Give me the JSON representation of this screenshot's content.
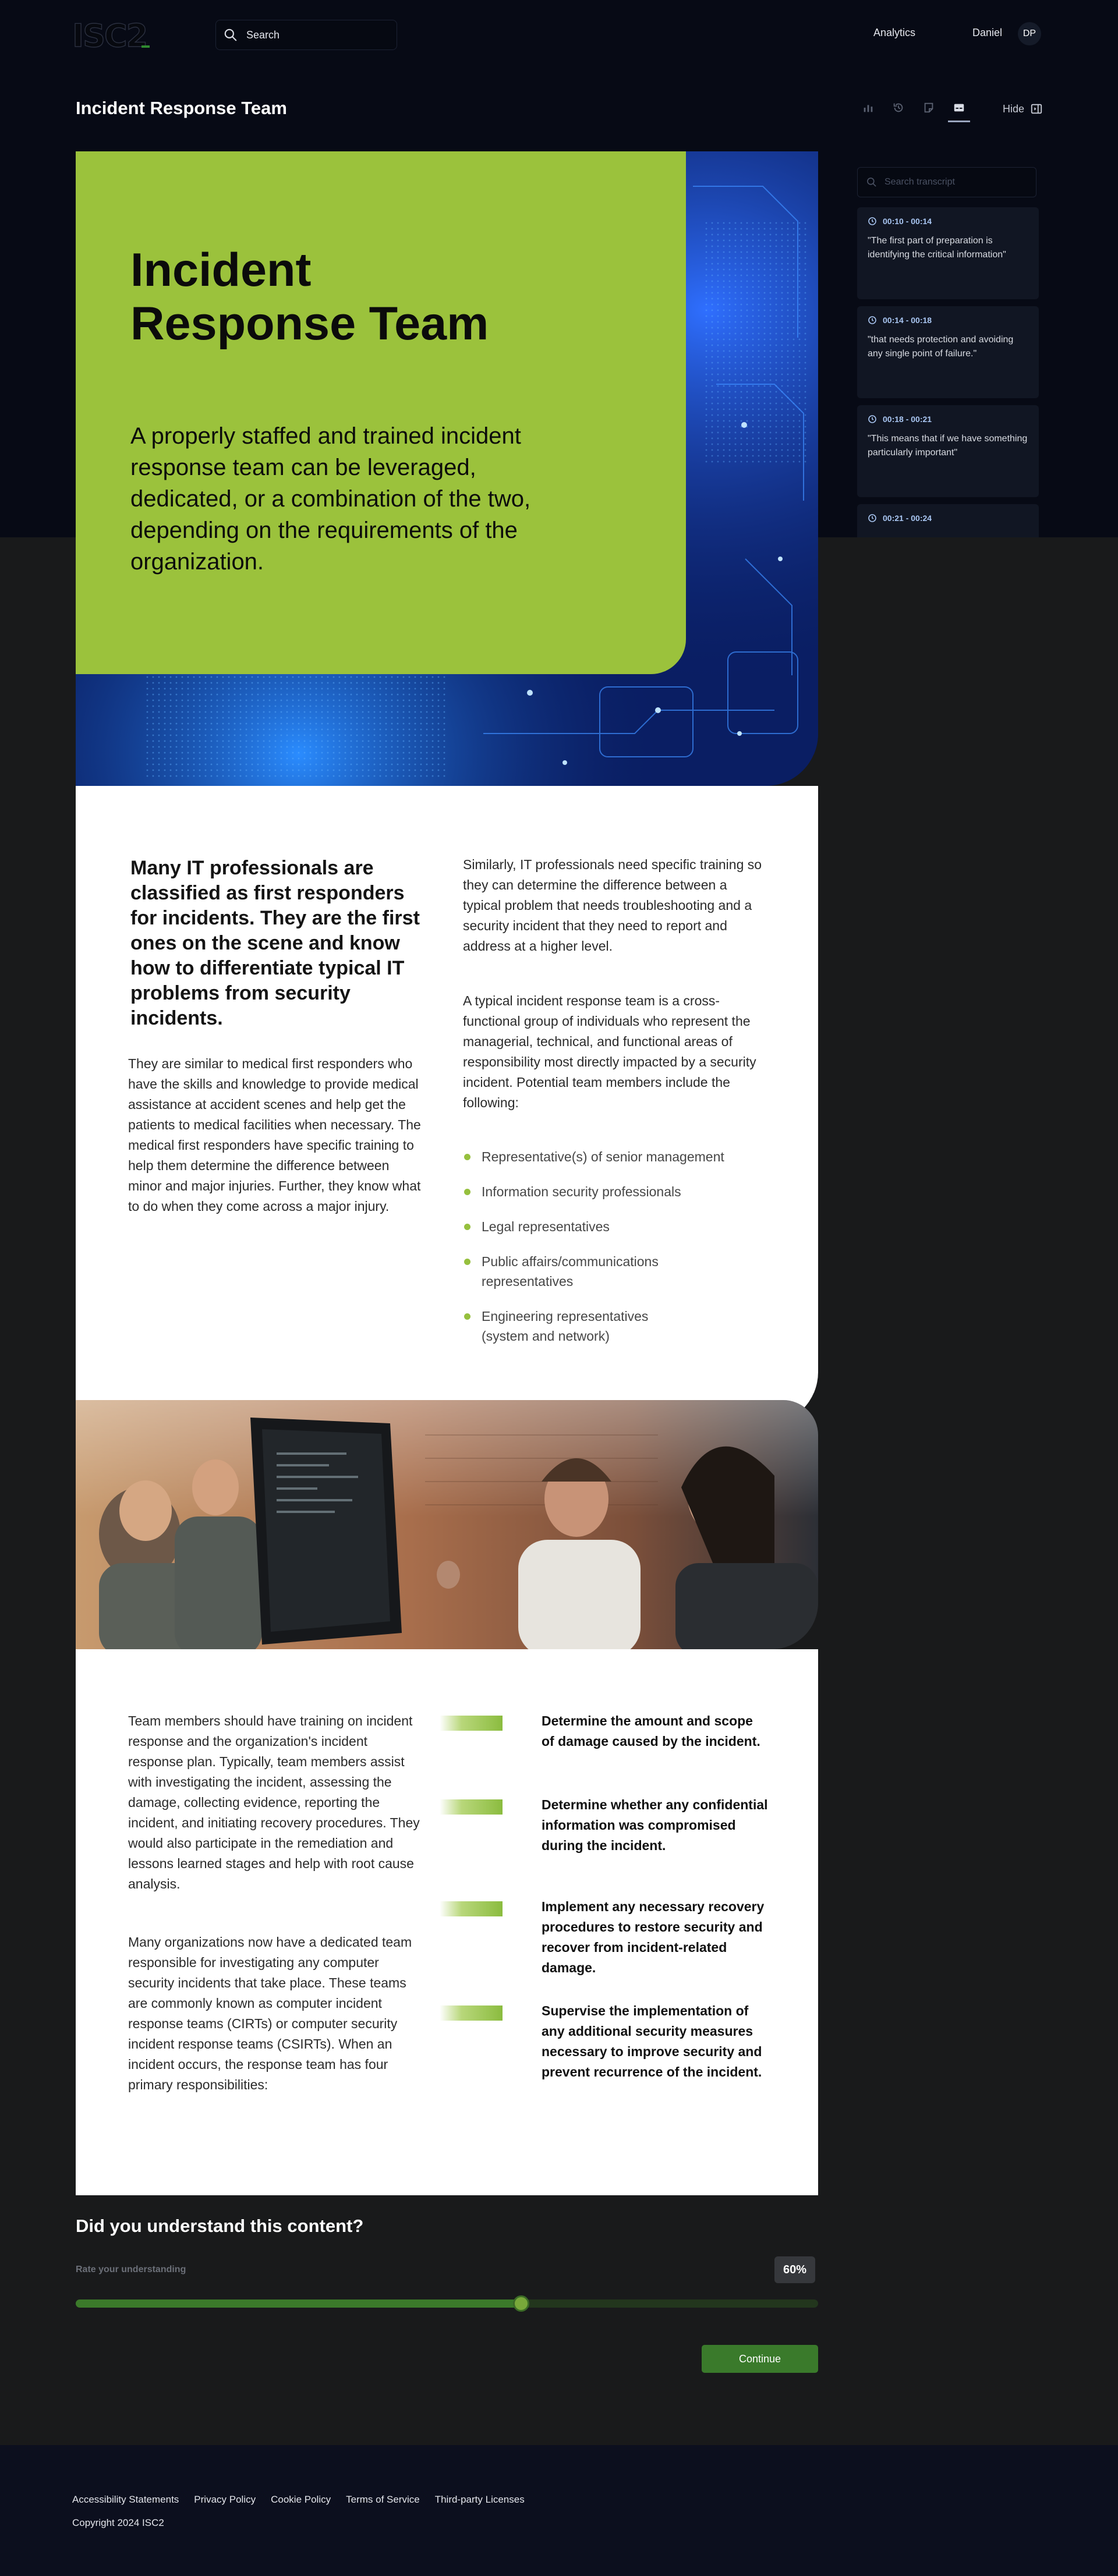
{
  "header": {
    "logo_text": "ISC2",
    "search_placeholder": "Search",
    "nav_analytics": "Analytics",
    "user_name": "Daniel",
    "user_initials": "DP"
  },
  "page": {
    "title": "Incident Response Team",
    "toolbar": {
      "icons": [
        "chart-icon",
        "history-icon",
        "notes-icon",
        "captions-icon"
      ],
      "active": "captions-icon",
      "hide_label": "Hide"
    }
  },
  "transcript": {
    "search_placeholder": "Search transcript",
    "items": [
      {
        "time": "00:10 - 00:14",
        "text": "\"The first part of preparation is identifying the critical information\""
      },
      {
        "time": "00:14 - 00:18",
        "text": "\"that needs protection and avoiding any single point of failure.\""
      },
      {
        "time": "00:18 - 00:21",
        "text": "\"This means that if we have something particularly important\""
      },
      {
        "time": "00:21 - 00:24",
        "text": ""
      }
    ]
  },
  "hero": {
    "title": "Incident Response Team",
    "subtitle": "A properly staffed and trained incident response team can be leveraged, dedicated, or a combination of the two, depending on the requirements of the organization.",
    "accent_color": "#9bc23c"
  },
  "section1": {
    "lead": "Many IT professionals are classified as first responders for incidents. They are the first ones on the scene and know how to differentiate typical IT problems from security incidents.",
    "para_left": "They are similar to medical first responders who have the skills and knowledge to provide medical assistance at accident scenes and help get the patients to medical facilities when necessary. The medical first responders have specific training to help them determine the difference between minor and major injuries. Further, they know what to do when they come across a major injury.",
    "para_right_1": "Similarly, IT professionals need specific training so they can determine the difference between a typical problem that needs troubleshooting and a security incident that they need to report and address at a higher level.",
    "para_right_2": "A typical incident response team is a cross-functional group of individuals who represent the managerial, technical, and functional areas of responsibility most directly impacted by a security incident. Potential team members include the following:",
    "members": [
      "Representative(s) of senior management",
      "Information security professionals",
      "Legal representatives",
      "Public affairs/communications representatives",
      "Engineering representatives (system and network)"
    ]
  },
  "section2": {
    "para_1": "Team members should have training on incident response and the organization's incident response plan. Typically, team members assist with investigating the incident, assessing the damage, collecting evidence, reporting the incident, and initiating recovery procedures. They would also participate in the remediation and lessons learned stages and help with root cause analysis.",
    "para_2": "Many organizations now have a dedicated team responsible for investigating any computer security incidents that take place. These teams are commonly known as computer incident response teams (CIRTs) or computer security incident response teams (CSIRTs). When an incident occurs, the response team has four primary responsibilities:",
    "responsibilities": [
      "Determine the amount and scope of damage caused by the incident.",
      "Determine whether any confidential information was compromised during the incident.",
      "Implement any necessary recovery procedures to restore security and recover from incident-related damage.",
      "Supervise the implementation of any additional security measures necessary to improve security and prevent recurrence of the incident."
    ]
  },
  "understanding": {
    "title": "Did you understand this content?",
    "label": "Rate your understanding",
    "value_text": "60%",
    "value": 0.6,
    "continue_label": "Continue"
  },
  "footer": {
    "links": [
      "Accessibility Statements",
      "Privacy Policy",
      "Cookie Policy",
      "Terms of Service",
      "Third-party Licenses"
    ],
    "copyright": "Copyright 2024 ISC2"
  }
}
